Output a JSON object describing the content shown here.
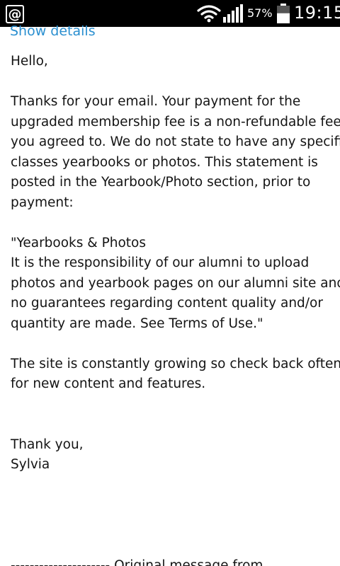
{
  "status_bar": {
    "battery_percent": "57%",
    "battery_level": 0.57,
    "time": "19:15",
    "icons": [
      "at-sign-icon",
      "wifi-icon",
      "signal-icon",
      "battery-icon"
    ]
  },
  "email": {
    "show_details_label": "Show details",
    "greeting": "Hello,",
    "para1_lines": [
      "Thanks for your email. Your payment for the",
      "upgraded membership fee is a non-refundable fee",
      "you agreed to. We do not state to have any specific",
      "classes yearbooks or photos. This statement is",
      "posted in the Yearbook/Photo section, prior to",
      "payment:"
    ],
    "quote_lines": [
      "\"Yearbooks & Photos",
      "It is the responsibility of our alumni to upload",
      "photos and yearbook pages on our alumni site and",
      "no guarantees regarding content quality and/or",
      "quantity are made. See Terms of Use.\""
    ],
    "para3_lines": [
      "The site is constantly growing so check back often",
      "for new content and features."
    ],
    "closing": "Thank you,",
    "signature": "Sylvia",
    "original_message_line": "--------------------- Original message from"
  }
}
